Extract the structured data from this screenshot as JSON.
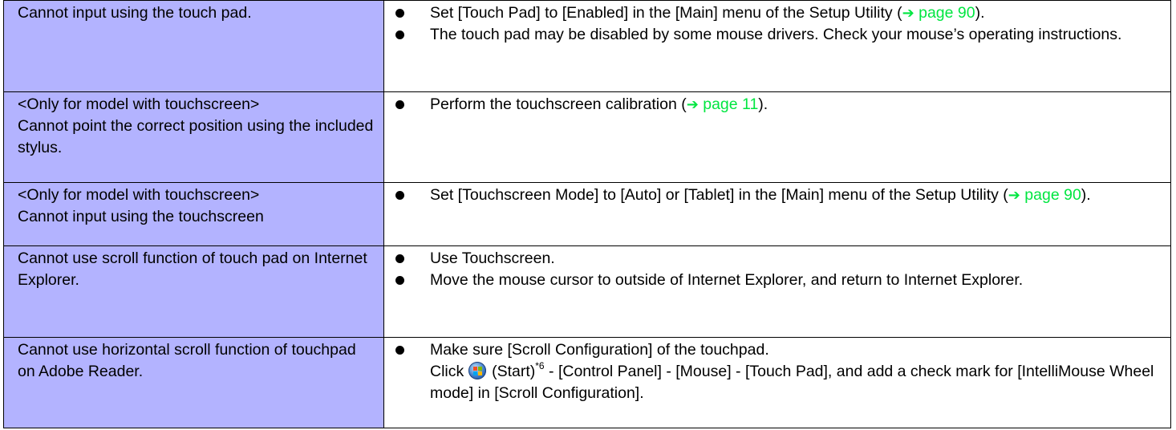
{
  "rows": [
    {
      "problem": [
        "Cannot input using the touch pad."
      ],
      "items": [
        {
          "pre": "Set [Touch Pad] to [Enabled] in the [Main] menu of the Setup Utility (",
          "arrow": "➔",
          "link": " page 90",
          "post": ")."
        },
        {
          "text": "The touch pad may be disabled by some mouse drivers. Check your mouse’s operating instructions."
        }
      ]
    },
    {
      "problem": [
        "<Only for model with touchscreen>",
        "Cannot point the correct position using the included stylus."
      ],
      "items": [
        {
          "pre": "Perform the touchscreen calibration (",
          "arrow": "➔",
          "link": " page 11",
          "post": ")."
        }
      ]
    },
    {
      "problem": [
        "<Only for model with touchscreen>",
        "Cannot input using the touchscreen"
      ],
      "items": [
        {
          "pre": "Set [Touchscreen Mode] to [Auto] or [Tablet] in the [Main] menu of the Setup Utility (",
          "arrow": "➔",
          "link": " page 90",
          "post": ")."
        }
      ]
    },
    {
      "problem": [
        "Cannot use scroll function of touch pad on Internet Explorer."
      ],
      "items": [
        {
          "text": "Use Touchscreen."
        },
        {
          "text": "Move the mouse cursor to outside of Internet Explorer, and return to Internet Explorer."
        }
      ]
    },
    {
      "problem": [
        "Cannot use horizontal scroll function of touchpad on Adobe Reader."
      ],
      "items": [
        {
          "text": "Make sure [Scroll Configuration] of the touchpad.",
          "line2_pre": "Click ",
          "icon": "windows-start-orb-icon",
          "line2_start": " (Start)",
          "footnote": "*6",
          "line2_post": " - [Control Panel] - [Mouse] - [Touch Pad], and add a check mark for [IntelliMouse Wheel mode] in [Scroll Configuration]."
        }
      ]
    }
  ],
  "colors": {
    "problem_bg": "#b3b3ff",
    "link": "#00e640",
    "border": "#000000"
  }
}
